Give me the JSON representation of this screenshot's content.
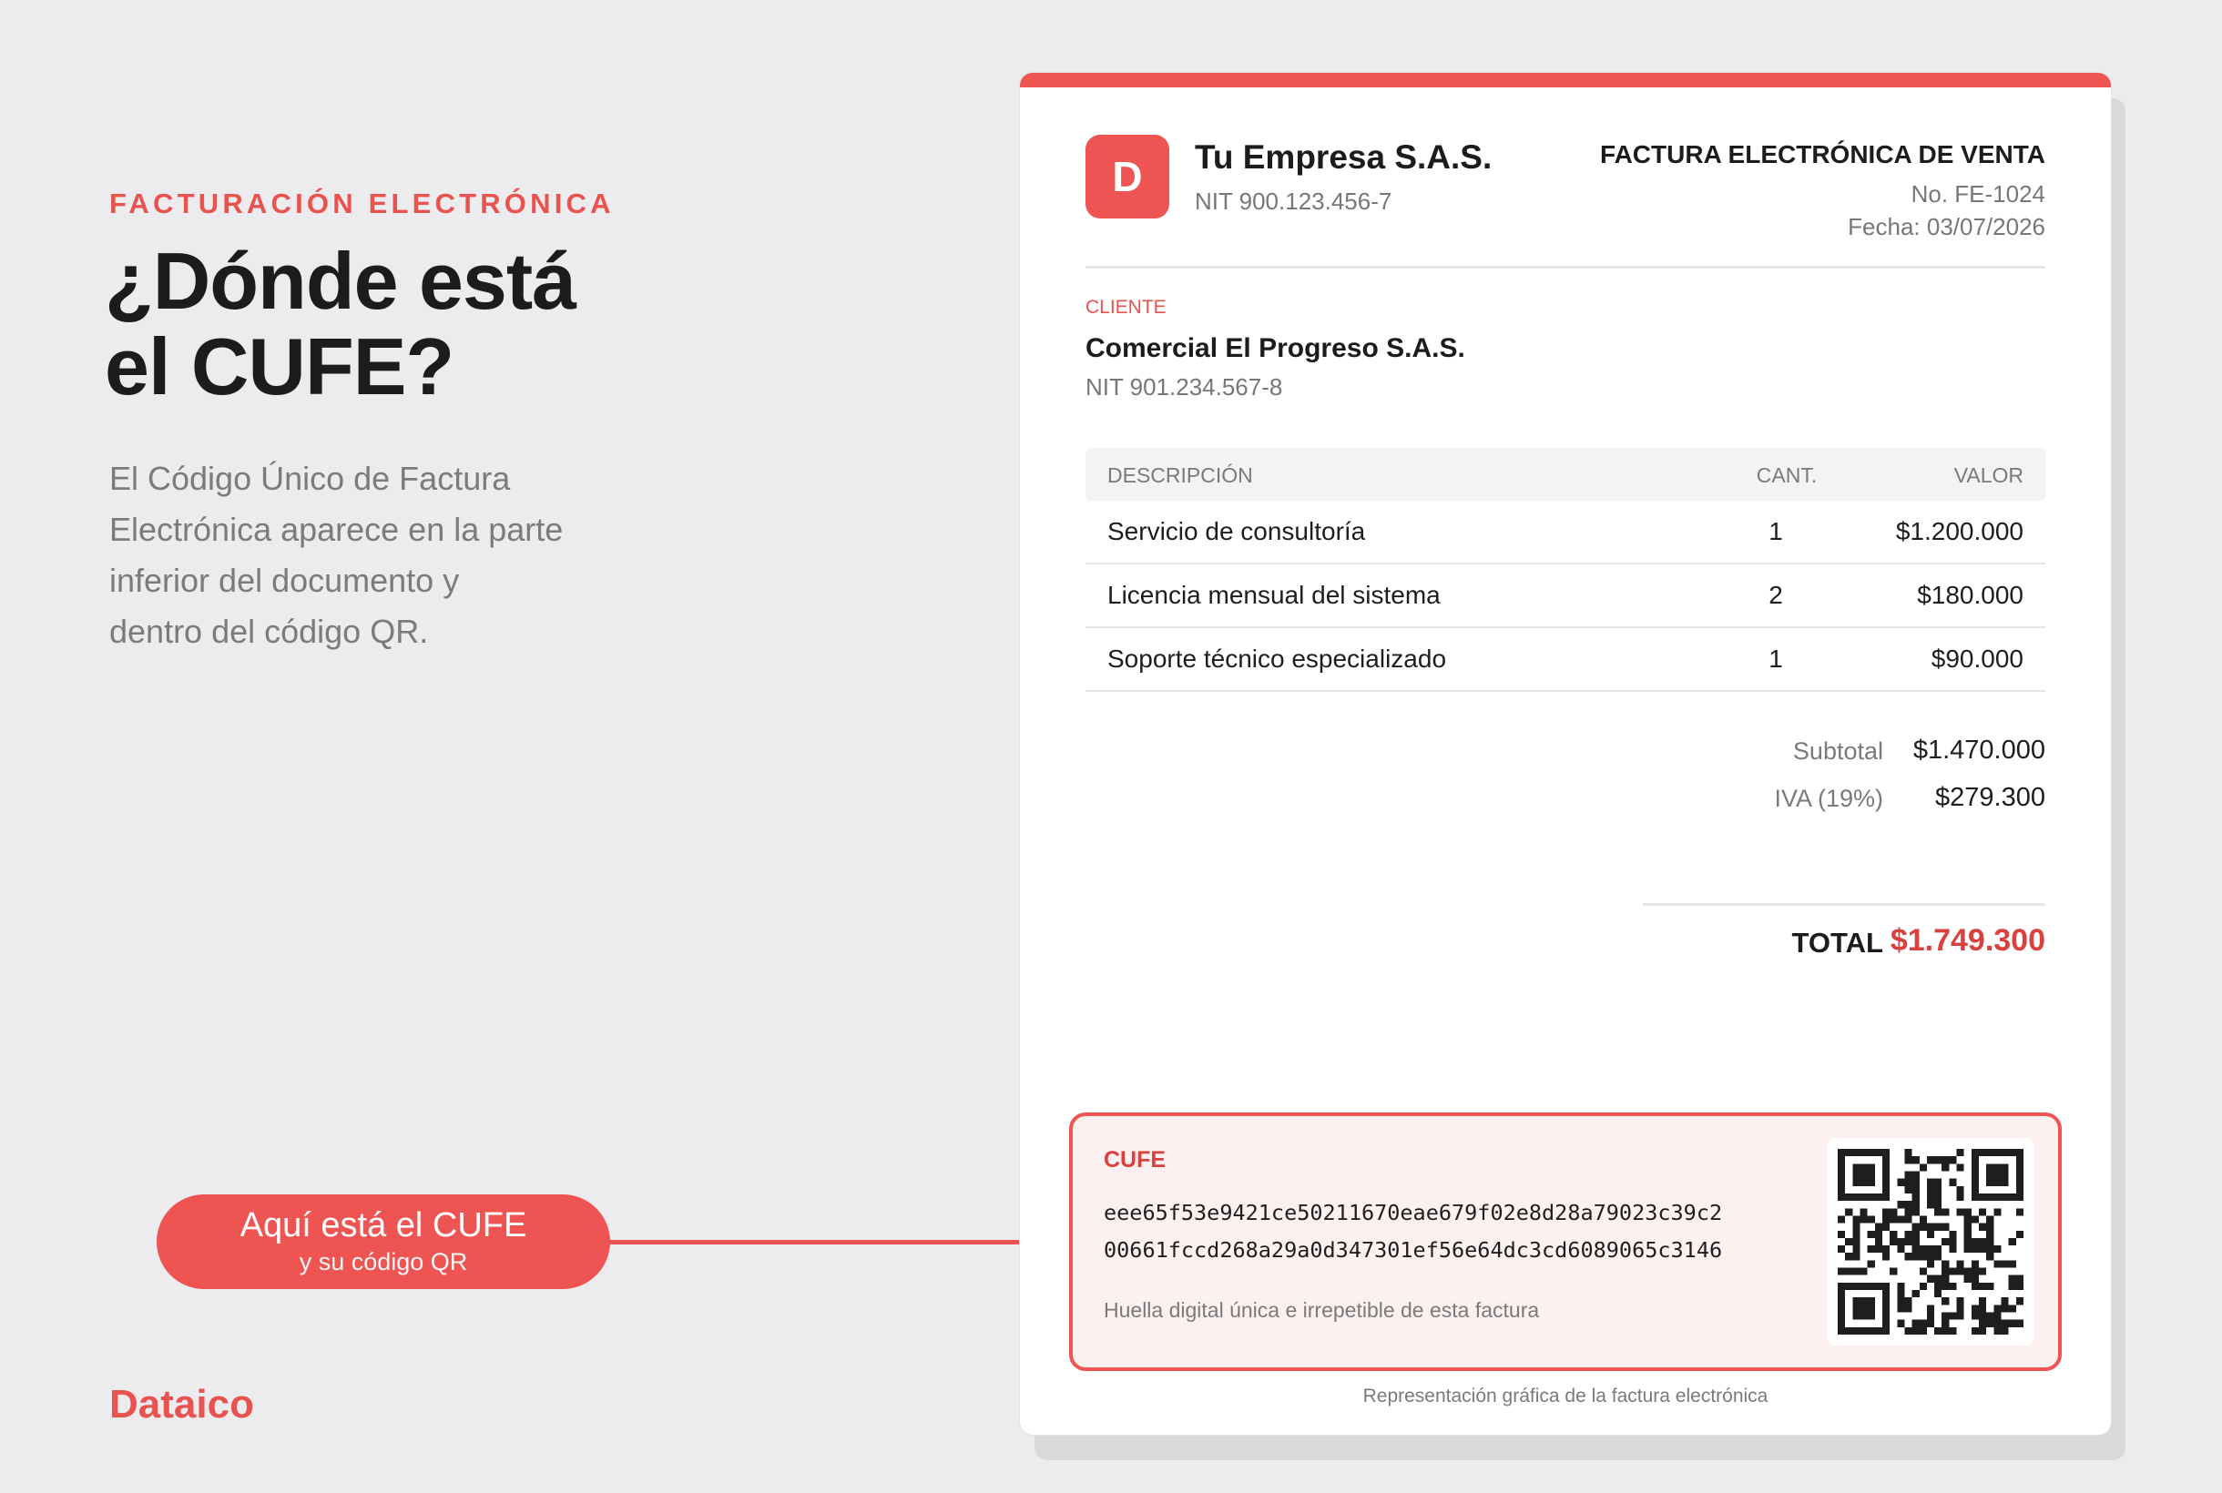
{
  "left": {
    "eyebrow": "FACTURACIÓN ELECTRÓNICA",
    "headline": [
      "¿Dónde está",
      "el CUFE?"
    ],
    "intro": [
      "El Código Único de Factura",
      "Electrónica aparece en la parte",
      "inferior del documento y",
      "dentro del código QR."
    ],
    "callout": {
      "main": "Aquí está el CUFE",
      "sub": "y su código QR"
    },
    "brand": "Dataico"
  },
  "invoice": {
    "logo_letter": "D",
    "company_name": "Tu Empresa S.A.S.",
    "company_nit": "NIT 900.123.456-7",
    "doc_title": "FACTURA ELECTRÓNICA DE VENTA",
    "doc_number": "No. FE-1024",
    "doc_date": "Fecha: 03/07/2026",
    "client_label": "CLIENTE",
    "client_name": "Comercial El Progreso S.A.S.",
    "client_nit": "NIT 901.234.567-8",
    "columns": {
      "description": "DESCRIPCIÓN",
      "quantity": "CANT.",
      "value": "VALOR"
    },
    "items": [
      {
        "description": "Servicio de consultoría",
        "quantity": "1",
        "value": "$1.200.000"
      },
      {
        "description": "Licencia mensual del sistema",
        "quantity": "2",
        "value": "$180.000"
      },
      {
        "description": "Soporte técnico especializado",
        "quantity": "1",
        "value": "$90.000"
      }
    ],
    "subtotal_label": "Subtotal",
    "subtotal_value": "$1.470.000",
    "tax_label": "IVA (19%)",
    "tax_value": "$279.300",
    "total_label": "TOTAL",
    "total_value": "$1.749.300",
    "cufe_label": "CUFE",
    "cufe_lines": [
      "eee65f53e9421ce50211670eae679f02e8d28a79023c39c2",
      "00661fccd268a29a0d347301ef56e64dc3cd6089065c3146"
    ],
    "cufe_caption": "Huella digital única e irrepetible de esta factura",
    "footer_note": "Representación gráfica de la factura electrónica"
  },
  "colors": {
    "accent": "#ee5452",
    "accent_dark": "#d9413f",
    "background": "#ececee"
  },
  "icons": {
    "qr": "qr-code"
  }
}
